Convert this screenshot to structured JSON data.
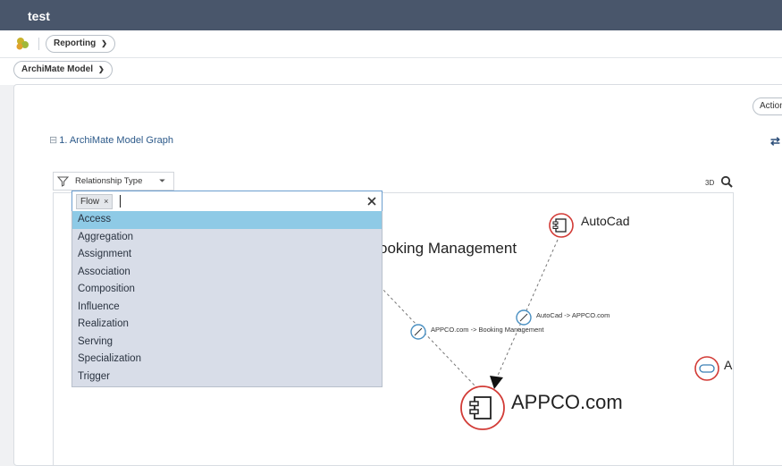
{
  "window": {
    "title": "test"
  },
  "toolbar": {
    "reporting_label": "Reporting"
  },
  "model_selector": {
    "label": "ArchiMate Model"
  },
  "actions_label": "Action",
  "section": {
    "toggle": "⊟",
    "title": "1. ArchiMate Model Graph"
  },
  "filter": {
    "label": "Relationship Type",
    "caret": "⏷"
  },
  "view_toggle": {
    "label": "3D"
  },
  "combo": {
    "chip_label": "Flow",
    "chip_remove": "×"
  },
  "options": [
    {
      "label": "Access",
      "selected": true
    },
    {
      "label": "Aggregation",
      "selected": false
    },
    {
      "label": "Assignment",
      "selected": false
    },
    {
      "label": "Association",
      "selected": false
    },
    {
      "label": "Composition",
      "selected": false
    },
    {
      "label": "Influence",
      "selected": false
    },
    {
      "label": "Realization",
      "selected": false
    },
    {
      "label": "Serving",
      "selected": false
    },
    {
      "label": "Specialization",
      "selected": false
    },
    {
      "label": "Trigger",
      "selected": false
    }
  ],
  "graph": {
    "nodes": [
      {
        "label": "AutoCad",
        "icon": "application-component-icon"
      },
      {
        "label": "ooking Management",
        "icon": "application-component-icon"
      },
      {
        "label": "APPCO.com",
        "icon": "application-component-icon"
      },
      {
        "label": "A",
        "icon": "application-service-icon"
      }
    ],
    "edges": [
      {
        "label": "AutoCad -> APPCO.com",
        "type": "flow"
      },
      {
        "label": "APPCO.com -> Booking Management",
        "type": "flow"
      }
    ]
  },
  "colors": {
    "topbar": "#49566b",
    "node_ring": "#d23b36",
    "edge_icon": "#4a90c2",
    "selected_option": "#8ecae6",
    "dropdown_bg": "#d8dde8"
  }
}
